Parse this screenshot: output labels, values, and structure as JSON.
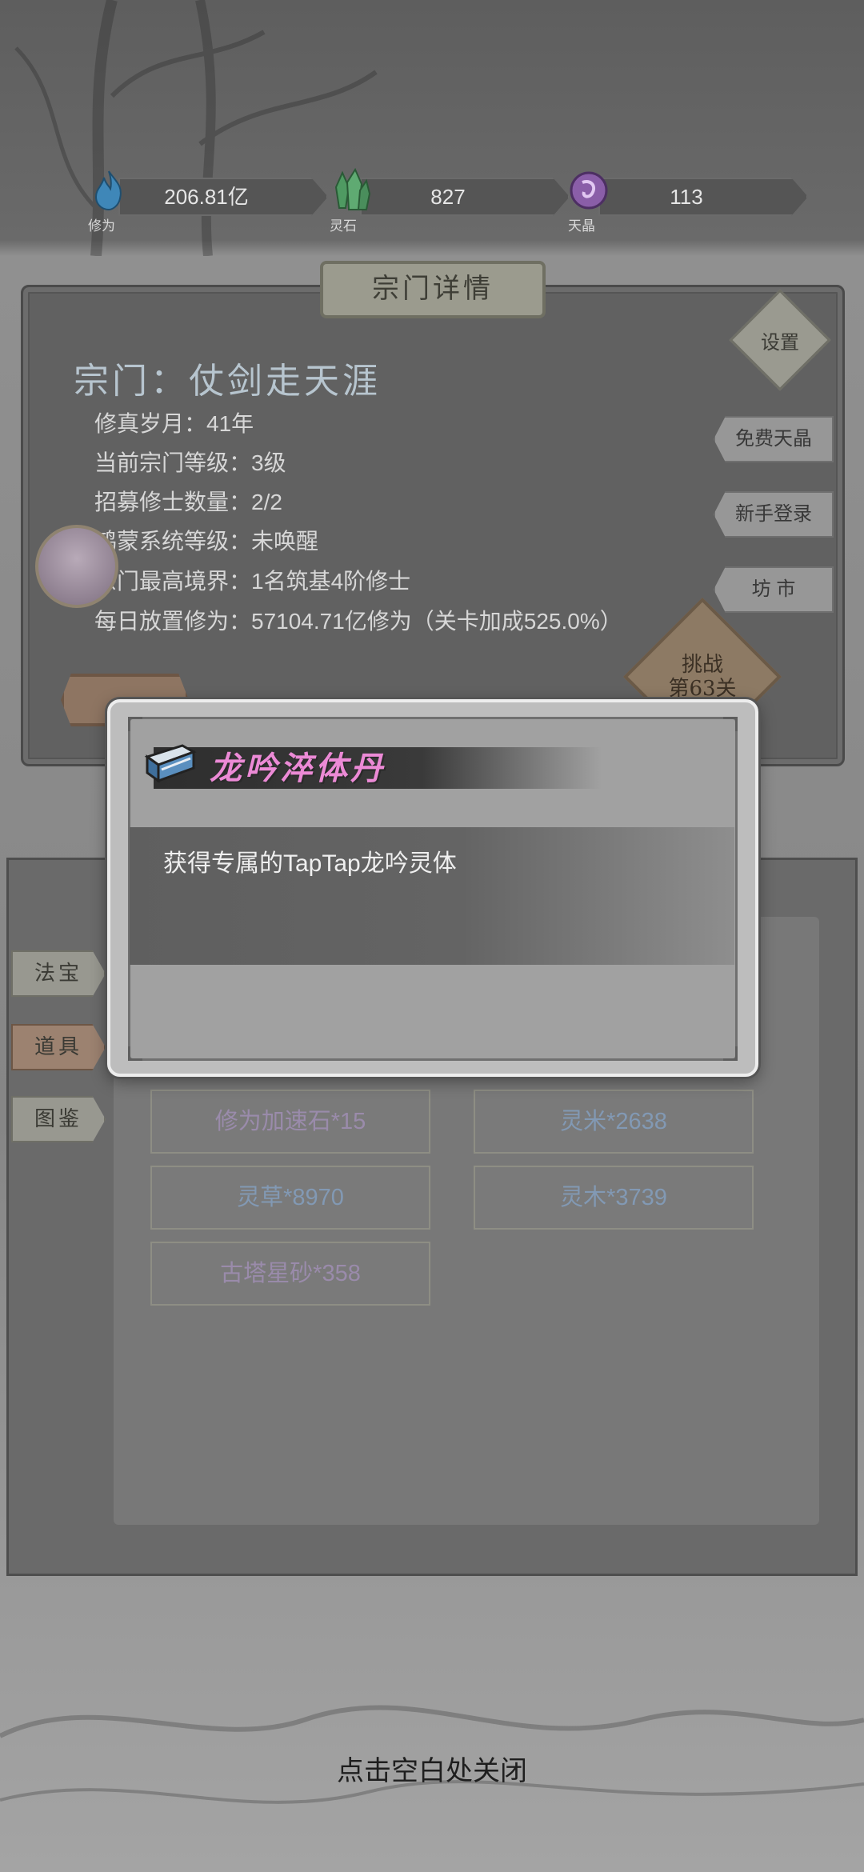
{
  "currencies": [
    {
      "name": "cultivation",
      "label": "修为",
      "value": "206.81亿",
      "icon": "blue-flame-icon",
      "color": "#3f87b8"
    },
    {
      "name": "spirit-stone",
      "label": "灵石",
      "value": "827",
      "icon": "green-crystal-icon",
      "color": "#4f9a62"
    },
    {
      "name": "sky-crystal",
      "label": "天晶",
      "value": "113",
      "icon": "purple-crystal-icon",
      "color": "#8a5ea8"
    }
  ],
  "panel": {
    "title": "宗门详情",
    "sect_name": "宗门：仗剑走天涯",
    "info": [
      "修真岁月：41年",
      "当前宗门等级：3级",
      "招募修士数量：2/2",
      "鸿蒙系统等级：未唤醒",
      "宗门最高境界：1名筑基4阶修士",
      "每日放置修为：57104.71亿修为（关卡加成525.0%）"
    ],
    "settings_label": "设置",
    "side_buttons": [
      "免费天晶",
      "新手登录",
      "坊 市"
    ],
    "challenge_label": "挑战\n第63关"
  },
  "tabs": [
    "法宝",
    "道具",
    "图鉴"
  ],
  "active_tab": 1,
  "items": [
    {
      "label": "修为加速石*15",
      "color": "purple"
    },
    {
      "label": "灵米*2638",
      "color": "blue"
    },
    {
      "label": "灵草*8970",
      "color": "blue"
    },
    {
      "label": "灵木*3739",
      "color": "blue"
    },
    {
      "label": "古塔星砂*358",
      "color": "purple"
    }
  ],
  "modal": {
    "title": "龙吟淬体丹",
    "description": "获得专属的TapTap龙吟灵体",
    "icon": "book-icon"
  },
  "close_hint": "点击空白处关闭"
}
